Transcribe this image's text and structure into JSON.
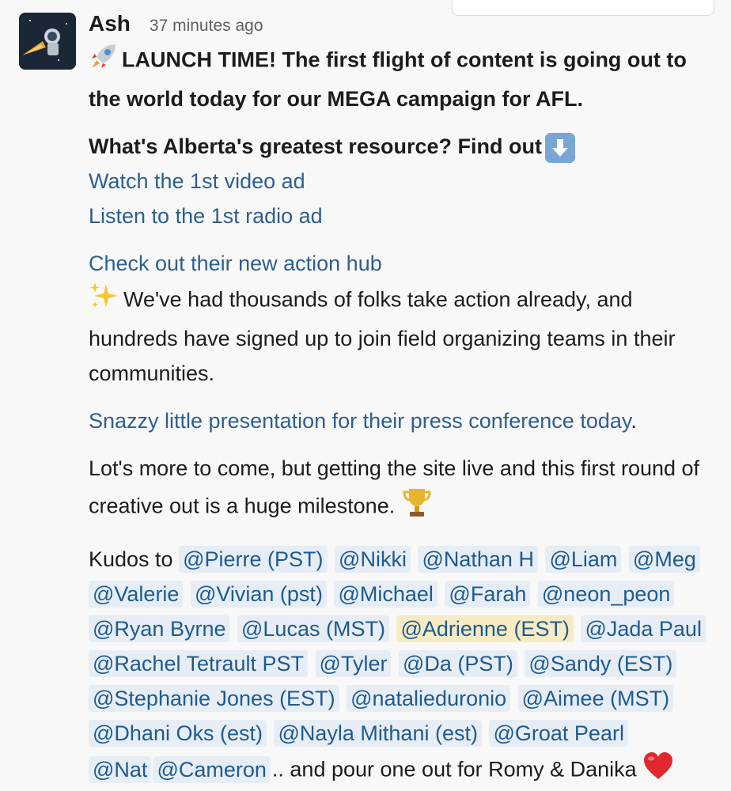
{
  "author": "Ash",
  "timestamp": "37 minutes ago",
  "headline": "LAUNCH TIME!  The first flight of content is going out to the world today for our MEGA campaign for AFL.",
  "question": "What's Alberta's greatest resource? Find out",
  "links": {
    "video": "Watch the 1st video ad",
    "radio": "Listen to the 1st radio ad",
    "hub": "Check out their new action hub",
    "presentation": "Snazzy little presentation for their press conference today"
  },
  "sparkle_text": "We've had thousands of folks take action already, and hundreds have signed up to join field organizing teams in their communities.",
  "period": ".",
  "milestone": "Lot's more to come, but getting the site live and this first round of creative out is a huge milestone.",
  "kudos_prefix": "Kudos to",
  "mentions": [
    "@Pierre (PST)",
    "@Nikki",
    "@Nathan H",
    "@Liam",
    "@Meg",
    "@Valerie",
    "@Vivian (pst)",
    "@Michael",
    "@Farah",
    "@neon_peon",
    "@Ryan Byrne",
    "@Lucas (MST)",
    "@Adrienne (EST)",
    "@Jada Paul",
    "@Rachel Tetrault PST",
    "@Tyler",
    "@Da (PST)",
    "@Sandy (EST)",
    "@Stephanie Jones (EST)",
    "@natalieduronio",
    "@Aimee (MST)",
    "@Dhani Oks (est)",
    "@Nayla Mithani (est)",
    "@Groat Pearl",
    "@Nat",
    "@Cameron"
  ],
  "highlighted_mention": "@Adrienne (EST)",
  "closing": ".. and pour one out for Romy & Danika",
  "icons": [
    "rocket-icon",
    "down-arrow-icon",
    "sparkles-icon",
    "trophy-icon",
    "heart-icon"
  ]
}
